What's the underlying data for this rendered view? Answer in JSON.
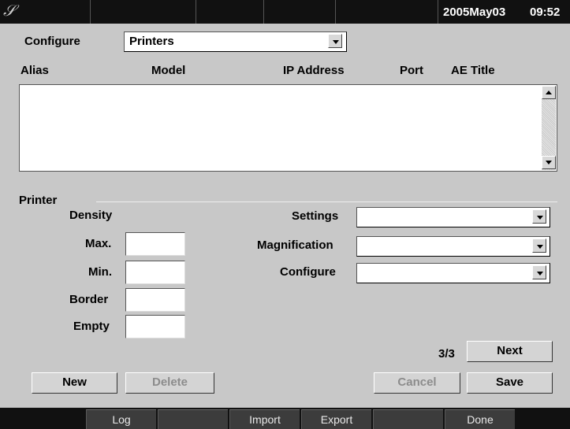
{
  "status_bar": {
    "logo_glyph": "𝒮",
    "date": "2005May03",
    "time": "09:52"
  },
  "configure": {
    "label": "Configure",
    "selected": "Printers"
  },
  "list": {
    "columns": [
      "Alias",
      "Model",
      "IP Address",
      "Port",
      "AE Title"
    ],
    "rows": []
  },
  "printer": {
    "section_label": "Printer",
    "density_label": "Density",
    "max_label": "Max.",
    "min_label": "Min.",
    "border_label": "Border",
    "empty_label": "Empty",
    "max_value": "",
    "min_value": "",
    "border_value": "",
    "empty_value": "",
    "settings_label": "Settings",
    "settings_value": "",
    "magnification_label": "Magnification",
    "magnification_value": "",
    "configure_label": "Configure",
    "configure_value": ""
  },
  "paging": {
    "page_indicator": "3/3",
    "next_label": "Next"
  },
  "actions": {
    "new_label": "New",
    "delete_label": "Delete",
    "cancel_label": "Cancel",
    "save_label": "Save"
  },
  "bottom_bar": {
    "log_label": "Log",
    "import_label": "Import",
    "export_label": "Export",
    "done_label": "Done"
  }
}
